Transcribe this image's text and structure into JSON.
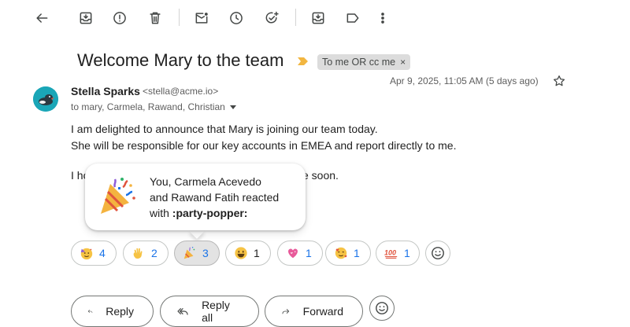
{
  "email": {
    "subject": "Welcome Mary to the team",
    "label": "To me OR cc me",
    "label_close": "×",
    "sender_name": "Stella Sparks",
    "sender_email": "<stella@acme.io>",
    "recipients": "to mary, Carmela, Rawand, Christian",
    "date": "Apr 9, 2025, 11:05 AM (5 days ago)",
    "body": [
      "I am delighted to announce that Mary is joining our team today.",
      "She will be responsible for our key accounts in EMEA and report directly to me.",
      "I ho",
      "e soon."
    ]
  },
  "tooltip": {
    "line1": "You, Carmela Acevedo",
    "line2": "and Rawand Fatih reacted",
    "line3_prefix": "with ",
    "line3_emoji": ":party-popper:"
  },
  "reactions": [
    {
      "emoji": "partying-face",
      "count": "4"
    },
    {
      "emoji": "waving-hand",
      "count": "2"
    },
    {
      "emoji": "party-popper",
      "count": "3"
    },
    {
      "emoji": "grinning-face",
      "count": "1"
    },
    {
      "emoji": "sparkling-heart",
      "count": "1"
    },
    {
      "emoji": "smiling-face-with-hearts",
      "count": "1"
    },
    {
      "emoji": "hundred-points",
      "count": "1"
    }
  ],
  "actions": {
    "reply": "Reply",
    "reply_all": "Reply all",
    "forward": "Forward"
  },
  "colors": {
    "accent": "#1a73e8",
    "importance": "#f2b640",
    "avatar": "#1aa6b7"
  },
  "icons": [
    "back-arrow-icon",
    "archive-icon",
    "report-spam-icon",
    "delete-icon",
    "mark-unread-icon",
    "snooze-icon",
    "add-to-tasks-icon",
    "move-to-icon",
    "label-icon",
    "more-icon",
    "star-icon",
    "add-reaction-icon",
    "reply-icon",
    "reply-all-icon",
    "forward-icon"
  ]
}
